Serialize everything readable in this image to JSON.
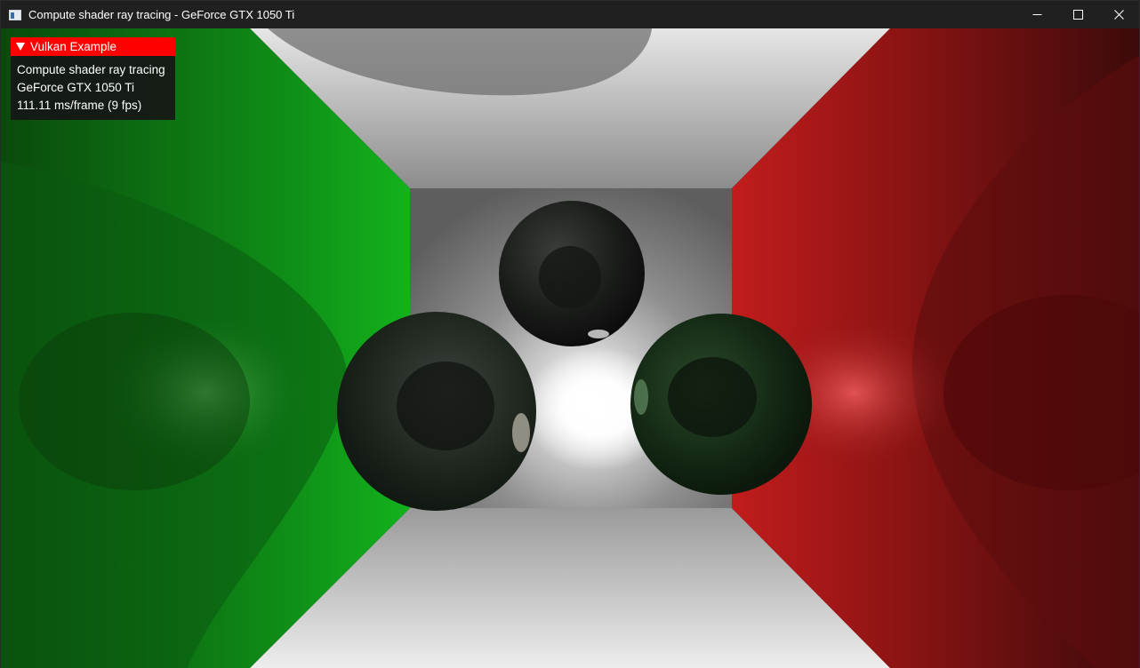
{
  "window": {
    "title": "Compute shader ray tracing - GeForce GTX 1050 Ti",
    "icon": "app-window-icon",
    "controls": [
      "minimize-icon",
      "maximize-icon",
      "close-icon"
    ]
  },
  "overlay": {
    "header": "Vulkan Example",
    "header_color": "#ff0000",
    "lines": [
      "Compute shader ray tracing",
      "GeForce GTX 1050 Ti",
      "111.11 ms/frame (9 fps)"
    ]
  },
  "scene": {
    "description_colors": {
      "left_wall": "#12a81a",
      "right_wall": "#c01818",
      "back_wall": "#8a8a8a",
      "light": "#ffffff"
    }
  }
}
